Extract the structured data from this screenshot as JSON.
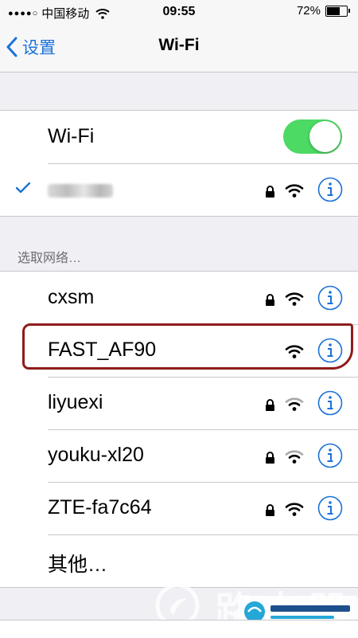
{
  "status_bar": {
    "signal": "●●●●○",
    "carrier": "中国移动",
    "time": "09:55",
    "battery": "72%",
    "battery_level": 0.72
  },
  "nav": {
    "back_label": "设置",
    "title": "Wi-Fi"
  },
  "wifi_toggle": {
    "label": "Wi-Fi",
    "on": true
  },
  "connected_network": {
    "connected": true,
    "locked": true,
    "signal_bars": 3
  },
  "section_header": "选取网络…",
  "networks": [
    {
      "name": "cxsm",
      "locked": true,
      "signal_bars": 3,
      "highlighted": false
    },
    {
      "name": "FAST_AF90",
      "locked": false,
      "signal_bars": 3,
      "highlighted": true
    },
    {
      "name": "liyuexi",
      "locked": true,
      "signal_bars": 2,
      "highlighted": false
    },
    {
      "name": "youku-xl20",
      "locked": true,
      "signal_bars": 2,
      "highlighted": false
    },
    {
      "name": "ZTE-fa7c64",
      "locked": true,
      "signal_bars": 3,
      "highlighted": false
    }
  ],
  "other_label": "其他…",
  "colors": {
    "accent": "#1b72d8",
    "toggle_on": "#4cd964",
    "highlight": "#8f1c1c",
    "background": "#efeff4"
  },
  "icons": [
    "chevron-left-icon",
    "checkmark-icon",
    "lock-icon",
    "wifi-signal-icon",
    "info-icon"
  ]
}
